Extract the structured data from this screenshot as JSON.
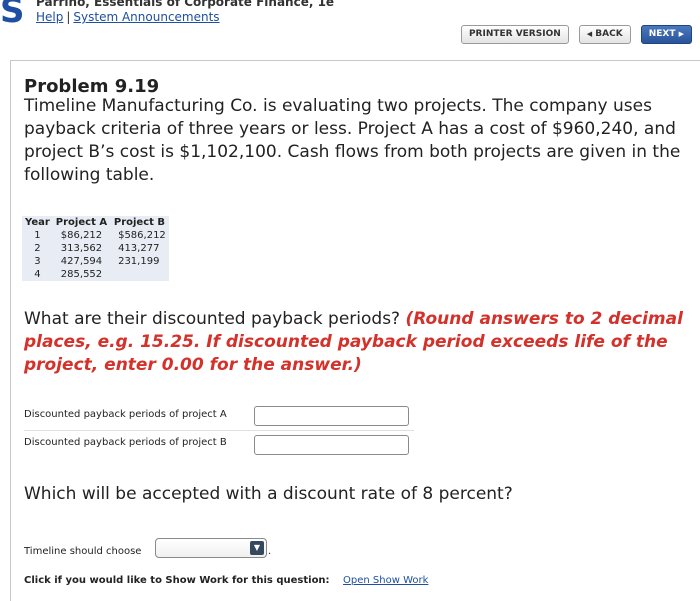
{
  "header": {
    "logo_letter": "S",
    "book_title": "Parrino, Essentials of Corporate Finance, 1e",
    "links": [
      "Help",
      "System Announcements"
    ],
    "link_separator": "|"
  },
  "toolbar": {
    "printer_label": "PRINTER VERSION",
    "back_label": "BACK",
    "next_label": "NEXT"
  },
  "problem": {
    "title": "Problem 9.19",
    "text": "Timeline Manufacturing Co. is evaluating two projects. The company uses payback criteria of three years or less. Project A has a cost of $960,240, and project B’s cost is $1,102,100. Cash flows from both projects are given in the following table."
  },
  "table": {
    "headers": [
      "Year",
      "Project A",
      "Project B"
    ],
    "rows": [
      [
        "1",
        "$86,212",
        "$586,212"
      ],
      [
        "2",
        "313,562",
        "413,277"
      ],
      [
        "3",
        "427,594",
        "231,199"
      ],
      [
        "4",
        "285,552",
        ""
      ]
    ]
  },
  "question1": {
    "text": "What are their discounted payback periods?",
    "note": "(Round answers to 2 decimal places, e.g. 15.25. If discounted payback period exceeds life of the project, enter 0.00 for the answer.)"
  },
  "answers": {
    "a_label": "Discounted payback periods of project A",
    "a_value": "",
    "b_label": "Discounted payback periods of project B",
    "b_value": ""
  },
  "question2": {
    "text": "Which will be accepted with a discount rate of 8 percent?",
    "choose_label": "Timeline should choose",
    "selected": "",
    "suffix": "."
  },
  "show_work": {
    "prompt": "Click if you would like to Show Work for this question:",
    "link": "Open Show Work"
  }
}
